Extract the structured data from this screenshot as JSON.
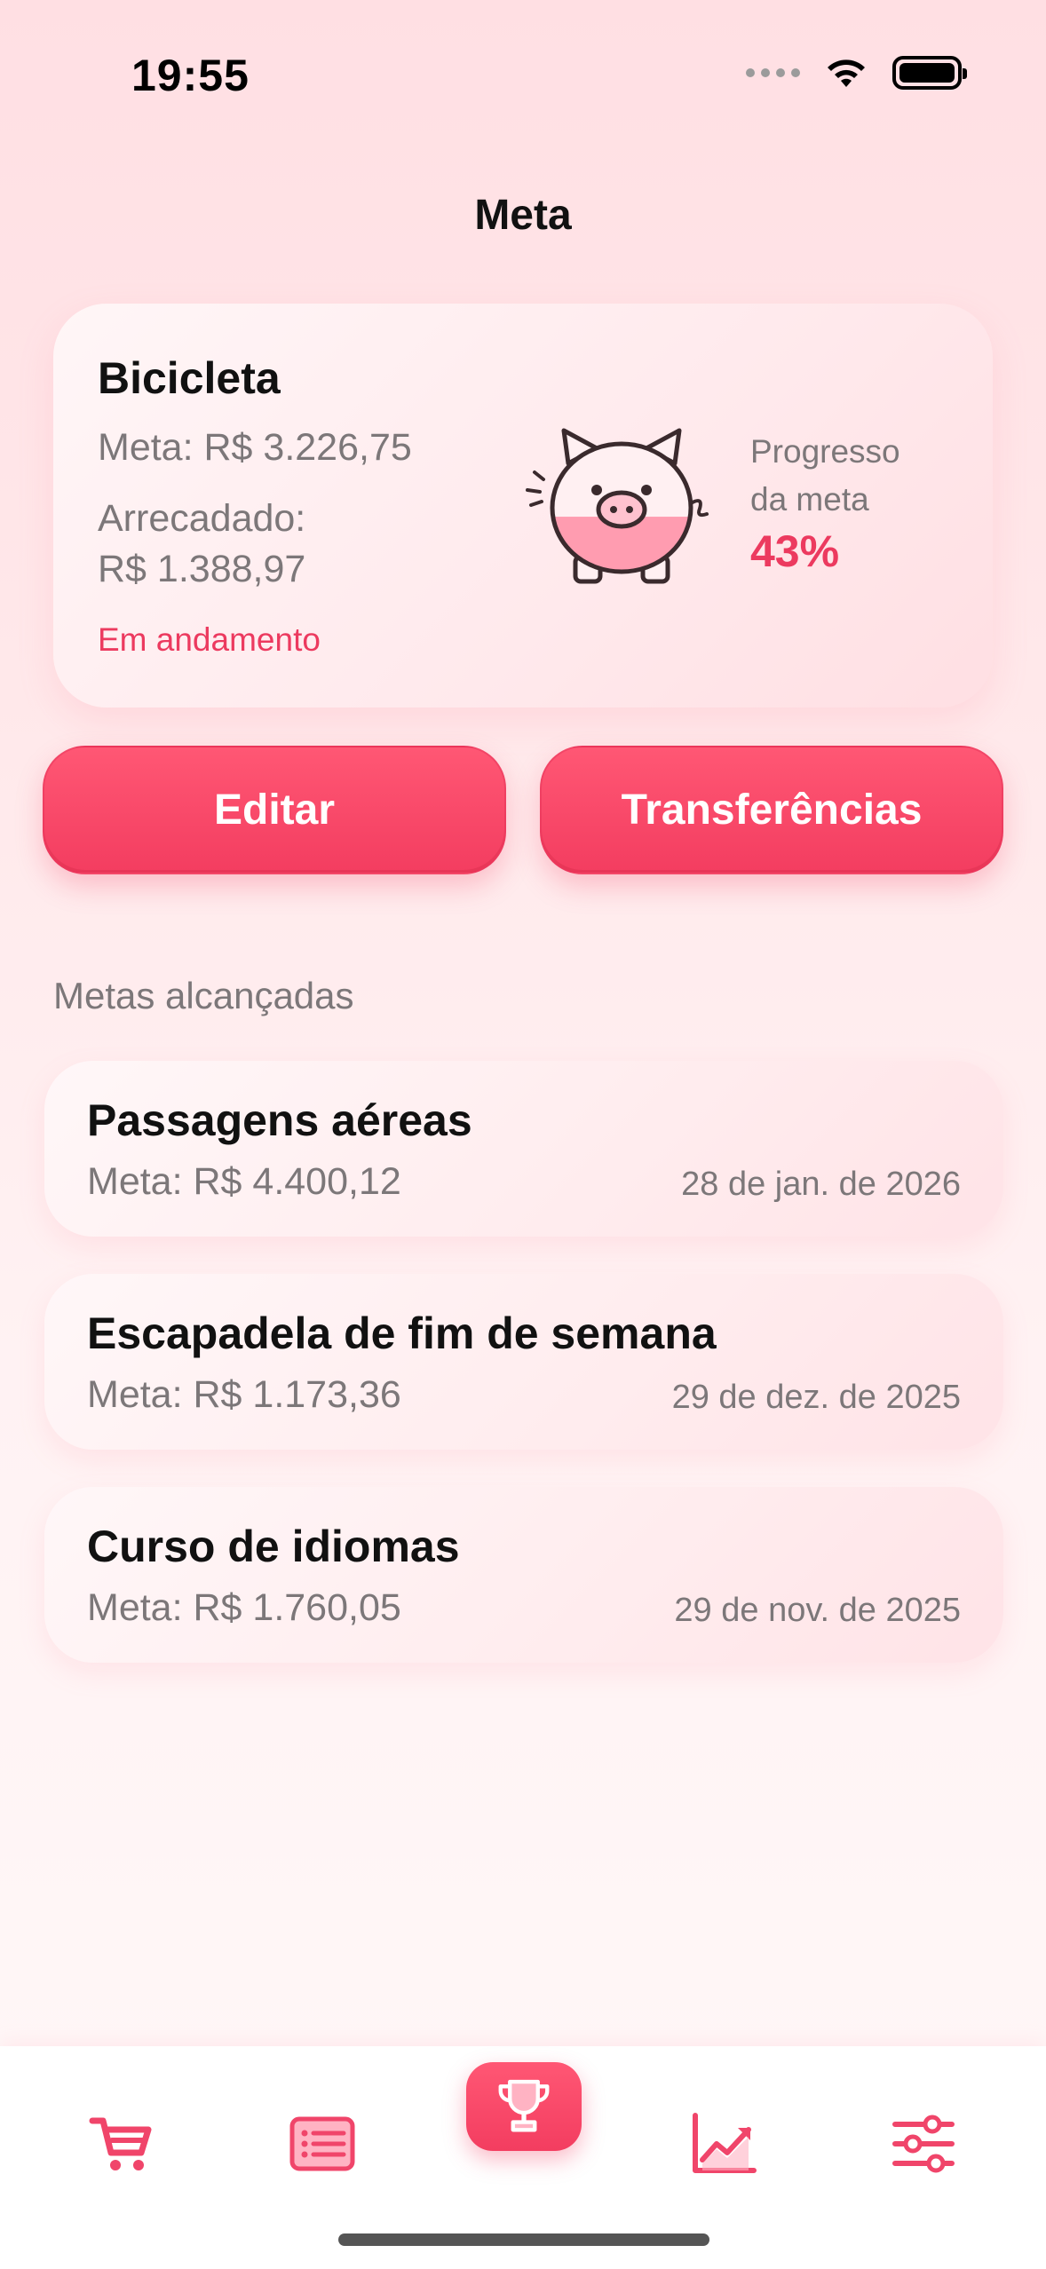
{
  "status_bar": {
    "time": "19:55"
  },
  "header": {
    "title": "Meta"
  },
  "current_goal": {
    "name": "Bicicleta",
    "target": "Meta: R$ 3.226,75",
    "raised_label": "Arrecadado:",
    "raised_value": "R$ 1.388,97",
    "status": "Em andamento",
    "progress_label": "Progresso da meta",
    "progress_percent": "43%",
    "progress_fraction": 0.43,
    "icon": "piggy-bank-icon"
  },
  "actions": {
    "edit_label": "Editar",
    "transfers_label": "Transferências"
  },
  "achieved": {
    "section_title": "Metas alcançadas",
    "items": [
      {
        "name": "Passagens aéreas",
        "target": "Meta: R$ 4.400,12",
        "date": "28 de jan. de 2026"
      },
      {
        "name": "Escapadela de fim de semana",
        "target": "Meta: R$ 1.173,36",
        "date": "29 de dez. de 2025"
      },
      {
        "name": "Curso de idiomas",
        "target": "Meta: R$ 1.760,05",
        "date": "29 de nov. de 2025"
      }
    ]
  },
  "tab_bar": {
    "tabs": [
      {
        "icon": "cart-icon"
      },
      {
        "icon": "list-icon"
      },
      {
        "icon": "trophy-icon",
        "active": true
      },
      {
        "icon": "chart-icon"
      },
      {
        "icon": "sliders-icon"
      }
    ]
  },
  "colors": {
    "accent": "#f33d60",
    "accent_text": "#ec3a5f",
    "muted_text": "#7c7779"
  }
}
